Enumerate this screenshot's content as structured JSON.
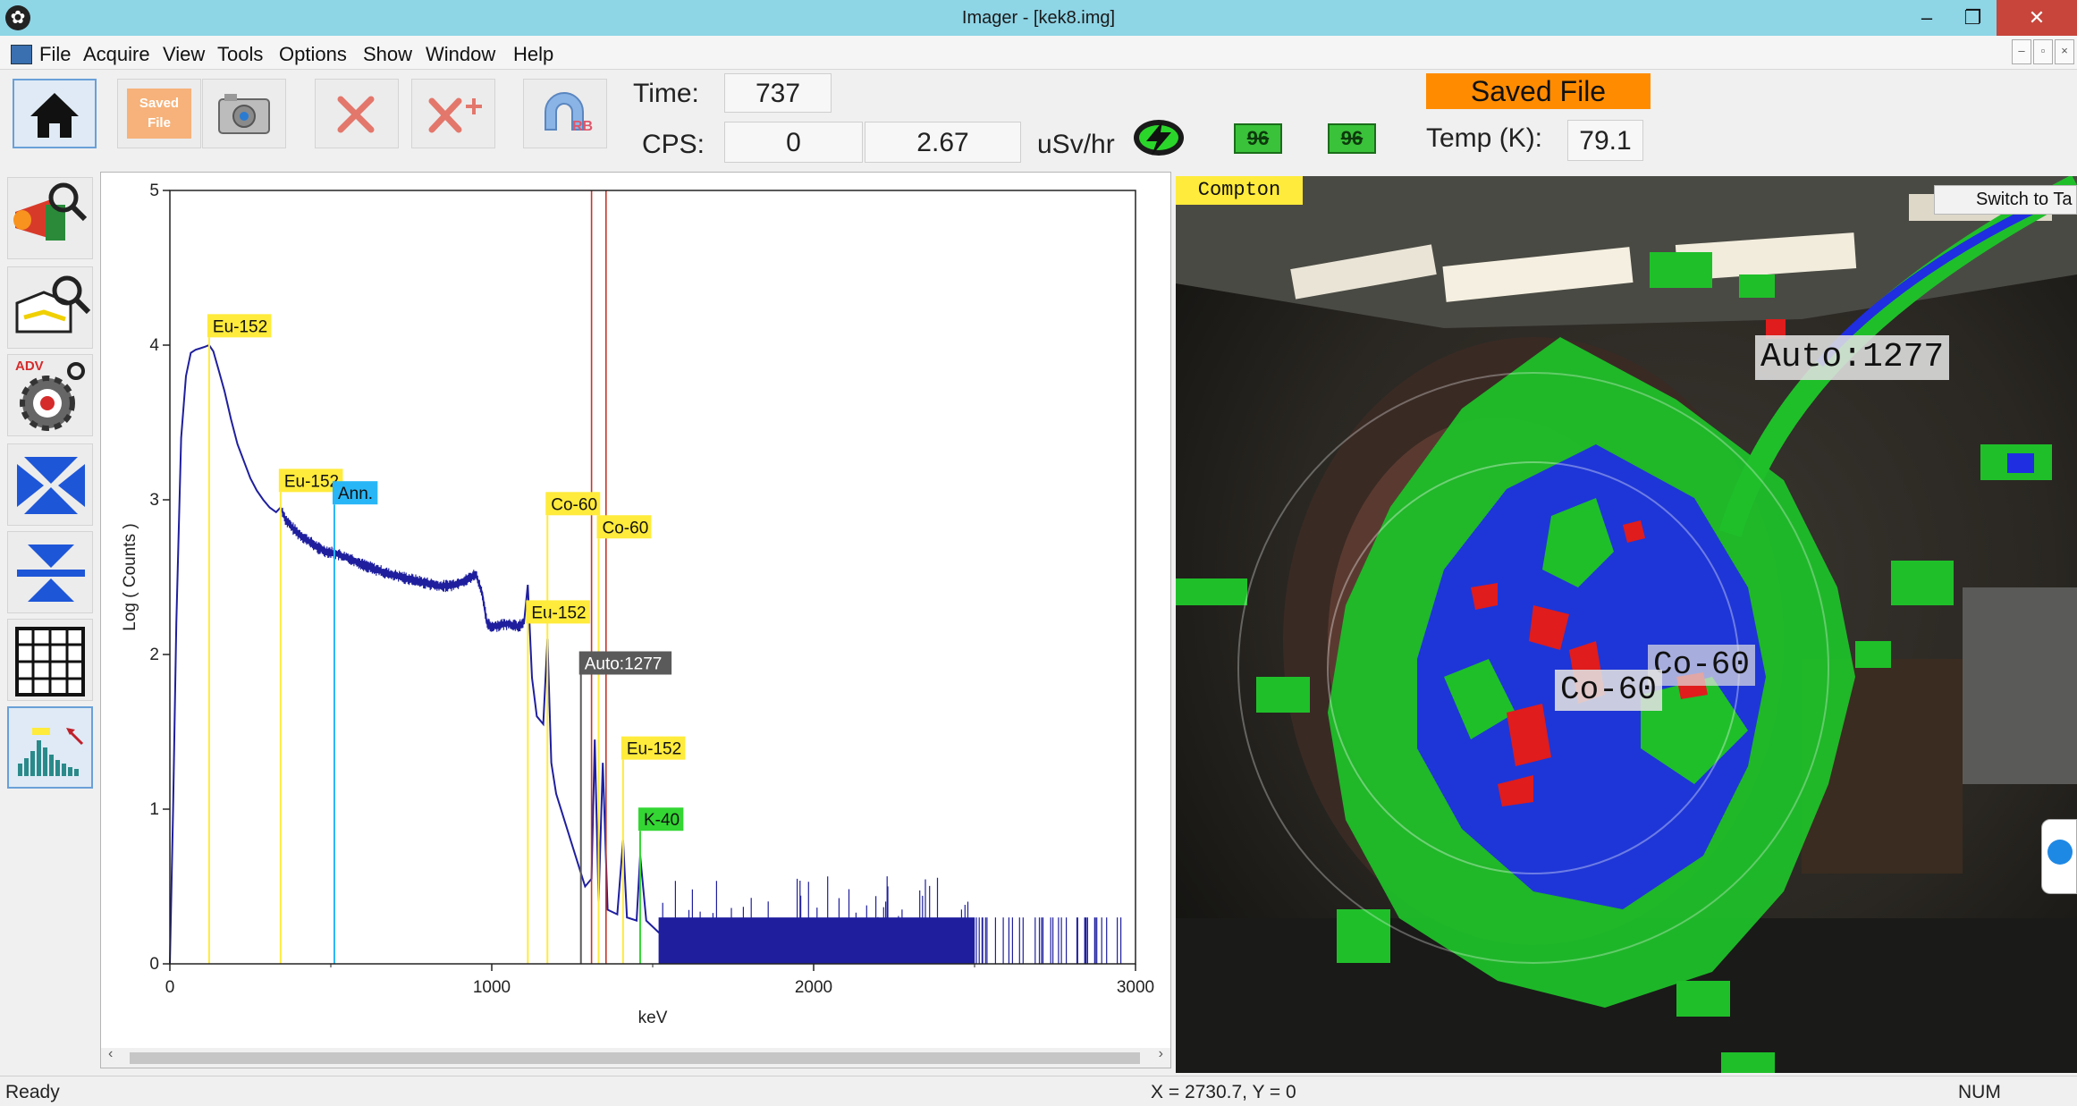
{
  "window": {
    "title": "Imager - [kek8.img]",
    "minimize": "–",
    "maximize": "❐",
    "close": "✕"
  },
  "menu": [
    "File",
    "Acquire",
    "View",
    "Tools",
    "Options",
    "Show",
    "Window",
    "Help"
  ],
  "mdi": [
    "–",
    "▫",
    "×"
  ],
  "toolbar": {
    "saved_file_button": "Saved File",
    "time_label": "Time:",
    "time_value": "737",
    "cps_label": "CPS:",
    "cps_value": "0",
    "dose_value": "2.67",
    "dose_unit": "uSv/hr",
    "saved_banner": "Saved File",
    "detector1": "96",
    "detector2": "96",
    "temp_label": "Temp (K):",
    "temp_value": "79.1",
    "adv_label": "ADV",
    "rb_label": "RB"
  },
  "chart_data": {
    "type": "line",
    "xlabel": "keV",
    "ylabel": "Log ( Counts )",
    "xlim": [
      0,
      3000
    ],
    "ylim": [
      0,
      5
    ],
    "xticks": [
      0,
      1000,
      2000,
      3000
    ],
    "yticks": [
      0,
      1,
      2,
      3,
      4,
      5
    ],
    "series": [
      {
        "color": "#1f1f9e",
        "x": [
          0,
          10,
          20,
          35,
          50,
          65,
          80,
          95,
          110,
          122,
          135,
          150,
          170,
          190,
          210,
          230,
          250,
          270,
          290,
          310,
          330,
          344,
          360,
          380,
          400,
          420,
          440,
          460,
          480,
          500,
          520,
          540,
          560,
          580,
          600,
          640,
          680,
          720,
          760,
          800,
          840,
          880,
          920,
          950,
          970,
          985,
          1000,
          1050,
          1080,
          1100,
          1112,
          1125,
          1140,
          1160,
          1173,
          1185,
          1200,
          1230,
          1260,
          1290,
          1310,
          1320,
          1332,
          1345,
          1360,
          1390,
          1408,
          1420,
          1450,
          1461,
          1480,
          1520
        ],
        "y": [
          0,
          1.0,
          2.2,
          3.4,
          3.8,
          3.95,
          3.97,
          3.98,
          3.99,
          4.0,
          3.96,
          3.85,
          3.7,
          3.52,
          3.36,
          3.25,
          3.14,
          3.06,
          3.0,
          2.95,
          2.92,
          2.95,
          2.87,
          2.82,
          2.78,
          2.75,
          2.72,
          2.69,
          2.67,
          2.66,
          2.65,
          2.63,
          2.62,
          2.6,
          2.58,
          2.55,
          2.52,
          2.5,
          2.48,
          2.46,
          2.44,
          2.45,
          2.48,
          2.52,
          2.4,
          2.2,
          2.18,
          2.2,
          2.18,
          2.2,
          2.45,
          1.85,
          1.6,
          1.55,
          2.1,
          1.3,
          1.1,
          0.9,
          0.7,
          0.5,
          0.55,
          1.45,
          0.4,
          1.3,
          0.35,
          0.32,
          0.8,
          0.3,
          0.28,
          0.7,
          0.28,
          0.2
        ]
      }
    ],
    "noise": {
      "x_from": 1520,
      "x_to": 2960
    },
    "markers": [
      {
        "x": 122,
        "label": "Eu-152",
        "color": "#ffeb3b",
        "label_y": 4.05
      },
      {
        "x": 344,
        "label": "Eu-152",
        "color": "#ffeb3b",
        "label_y": 3.05
      },
      {
        "x": 511,
        "label": "Ann.",
        "color": "#29b6f6",
        "label_y": 2.97
      },
      {
        "x": 1112,
        "label": "Eu-152",
        "color": "#ffeb3b",
        "label_y": 2.2
      },
      {
        "x": 1173,
        "label": "Co-60",
        "color": "#ffeb3b",
        "label_y": 2.9
      },
      {
        "x": 1332,
        "label": "Co-60",
        "color": "#ffeb3b",
        "label_y": 2.75
      },
      {
        "x": 1277,
        "label": "Auto:1277",
        "color": "#5a5a5a",
        "label_y": 1.87
      },
      {
        "x": 1408,
        "label": "Eu-152",
        "color": "#ffeb3b",
        "label_y": 1.32
      },
      {
        "x": 1461,
        "label": "K-40",
        "color": "#33d633",
        "label_y": 0.86
      }
    ],
    "roi_lines": [
      1310,
      1355
    ]
  },
  "image_panel": {
    "mode_tag": "Compton",
    "switch_button": "Switch to Ta",
    "label_auto": "Auto:1277",
    "label_co60_a": "Co-60",
    "label_co60_b": "Co-60"
  },
  "status": {
    "left": "Ready",
    "coords": "X = 2730.7, Y = 0",
    "num": "NUM"
  }
}
